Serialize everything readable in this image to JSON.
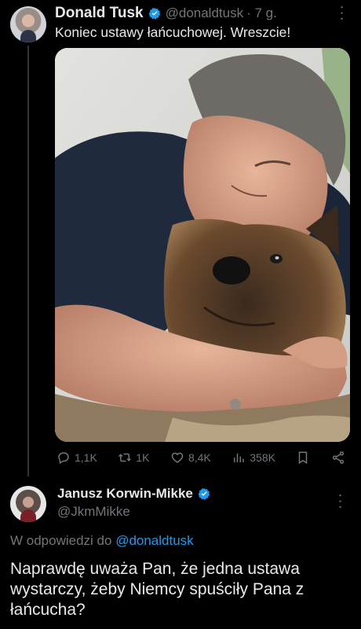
{
  "tweet": {
    "author_name": "Donald Tusk",
    "author_handle": "@donaldtusk",
    "time": "· 7 g.",
    "text": "Koniec ustawy łańcuchowej. Wreszcie!",
    "metrics": {
      "replies": "1,1K",
      "reposts": "1K",
      "likes": "8,4K",
      "views": "358K"
    }
  },
  "reply": {
    "author_name": "Janusz Korwin-Mikke",
    "author_handle": "@JkmMikke",
    "reply_prefix": "W odpowiedzi do ",
    "reply_to_handle": "@donaldtusk",
    "text": "Naprawdę uważa Pan, że jedna ustawa wystarczy, żeby Niemcy spuściły Pana z łańcucha?"
  },
  "colors": {
    "background": "#000000",
    "text": "#e7e9ea",
    "muted": "#71767b",
    "accent": "#1d9bf0"
  }
}
